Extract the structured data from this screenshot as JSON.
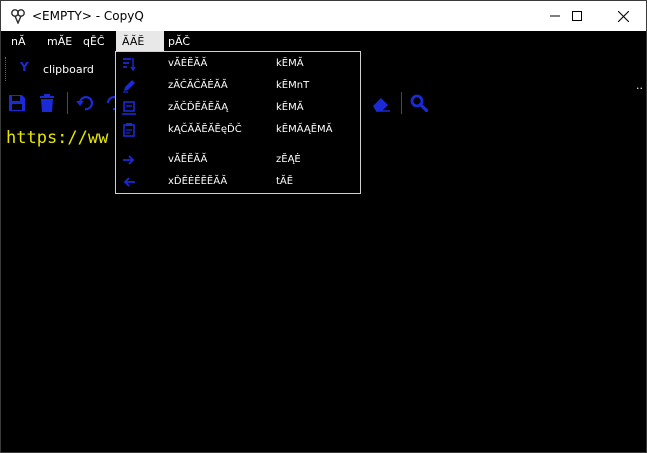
{
  "window": {
    "title": "<EMPTY> - CopyQ",
    "minimize_glyph": "─",
    "maximize_glyph": "☐",
    "close_glyph": "✕"
  },
  "menubar": {
    "items": [
      {
        "label": "nĂ"
      },
      {
        "label": "mĂE"
      },
      {
        "label": "qĒĈ"
      },
      {
        "label": "ĂĂĔ"
      },
      {
        "label": "pĂČ"
      }
    ]
  },
  "tabs": {
    "current": "clipboard",
    "icon_letter": "Y",
    "more": ".."
  },
  "content": {
    "text": "https://ww"
  },
  "dropdown": {
    "items": [
      {
        "label": "vĂĖĔĂĂ",
        "shortcut": "kĒMĂ",
        "icon": "sort-icon"
      },
      {
        "label": "zĂĈĂĈĂĖĂĂ",
        "shortcut": "kĒMnT",
        "icon": "edit-icon"
      },
      {
        "label": "zĂČĎĔĂĔĂĄ",
        "shortcut": "kĒMĂ",
        "icon": "reverse-icon"
      },
      {
        "label": "kĄČĂĂĔĂĔęĎČ",
        "shortcut": "kĒMĂĄĔMĂ",
        "icon": "paste-icon"
      },
      {
        "label": "vĂĔĔĂĂ",
        "shortcut": "zĔĄĖ",
        "icon": "next-icon"
      },
      {
        "label": "xĎĔĖĔĔĔĂĂ",
        "shortcut": "tĂĔ",
        "icon": "previous-icon"
      }
    ]
  },
  "colors": {
    "accent": "#1a2bd6",
    "background": "#000000",
    "text": "#e6e600"
  }
}
